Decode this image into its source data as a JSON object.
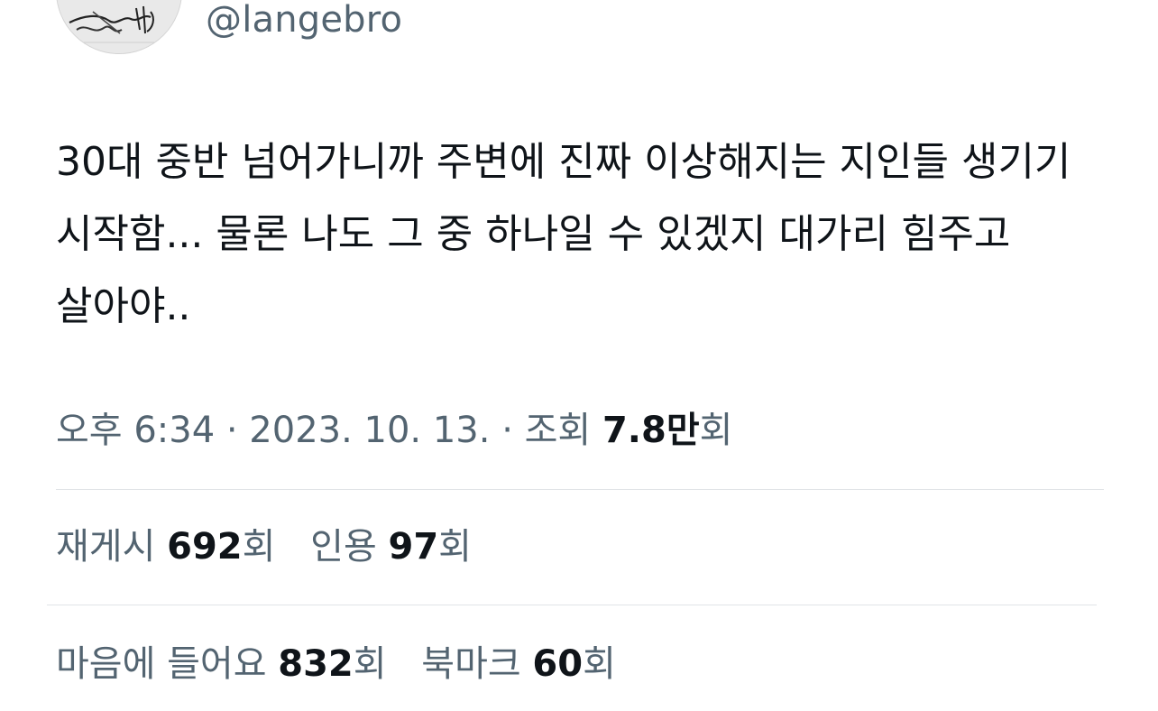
{
  "user": {
    "handle": "@langebro",
    "avatar_icon": "handwriting-sketch-avatar"
  },
  "tweet": {
    "text": "30대 중반 넘어가니까 주변에 진짜 이상해지는 지인들 생기기 시작함... 물론 나도 그 중 하나일 수 있겠지 대가리 힘주고 살아야.."
  },
  "meta": {
    "time": "오후 6:34",
    "separator": "·",
    "date": "2023. 10. 13.",
    "views_label": "조회",
    "views_number": "7.8만",
    "views_unit": "회"
  },
  "stats": {
    "reposts": {
      "label": "재게시",
      "value": "692",
      "unit": "회"
    },
    "quotes": {
      "label": "인용",
      "value": "97",
      "unit": "회"
    },
    "likes": {
      "label": "마음에 들어요",
      "value": "832",
      "unit": "회"
    },
    "bookmarks": {
      "label": "북마크",
      "value": "60",
      "unit": "회"
    }
  },
  "colors": {
    "text_primary": "#0f1419",
    "text_secondary": "#536471",
    "divider": "#e1e4e7",
    "background": "#ffffff"
  }
}
